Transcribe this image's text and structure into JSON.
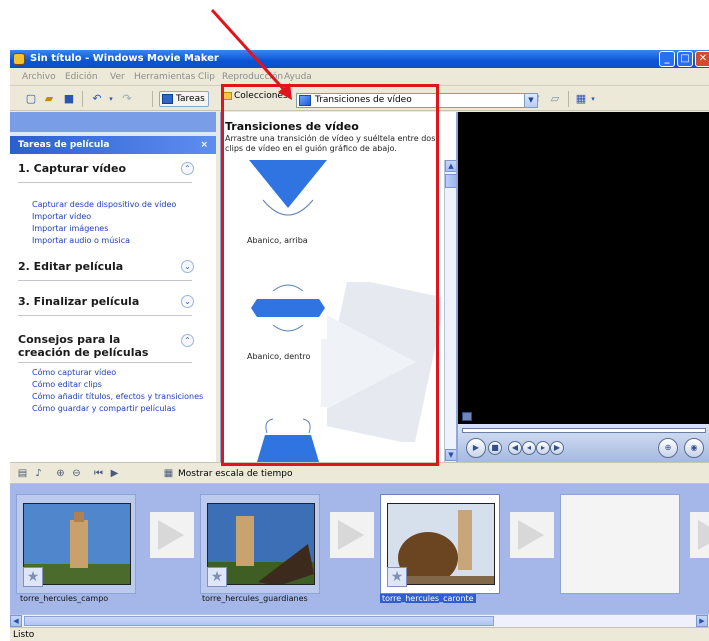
{
  "window": {
    "title": "Sin título - Windows Movie Maker",
    "minimize": "_",
    "maximize": "□",
    "close": "✕"
  },
  "menu": [
    "Archivo",
    "Edición",
    "Ver",
    "Herramientas",
    "Clip",
    "Reproducción",
    "Ayuda"
  ],
  "toolbar": {
    "tareas_label": "Tareas",
    "colecciones_label": "Colecciones",
    "collection_selected": "Transiciones de vídeo"
  },
  "taskpane": {
    "header": "Tareas de película",
    "close": "×",
    "sections": [
      {
        "title": "1. Capturar vídeo",
        "links": [
          "Capturar desde dispositivo de vídeo",
          "Importar vídeo",
          "Importar imágenes",
          "Importar audio o música"
        ]
      },
      {
        "title": "2. Editar película",
        "links": []
      },
      {
        "title": "3. Finalizar película",
        "links": []
      },
      {
        "title": "Consejos para la creación de películas",
        "links": [
          "Cómo capturar vídeo",
          "Cómo editar clips",
          "Cómo añadir títulos, efectos y transiciones",
          "Cómo guardar y compartir películas"
        ]
      }
    ]
  },
  "content": {
    "heading": "Transiciones de vídeo",
    "description": "Arrastre una transición de vídeo y suéltela entre dos clips de vídeo en el guión gráfico de abajo.",
    "transitions": [
      "Abanico, arriba",
      "Abanico, dentro"
    ]
  },
  "storyboard": {
    "show_timeline_label": "Mostrar escala de tiempo",
    "clips": [
      {
        "label": "torre_hercules_campo",
        "selected": false
      },
      {
        "label": "torre_hercules_guardianes",
        "selected": false
      },
      {
        "label": "torre_hercules_caronte",
        "selected": true
      }
    ]
  },
  "status": {
    "text": "Listo"
  },
  "colors": {
    "highlight": "#e0141b",
    "title_bar": "#0a55d6",
    "storyboard_bg": "#a4b7e8"
  }
}
